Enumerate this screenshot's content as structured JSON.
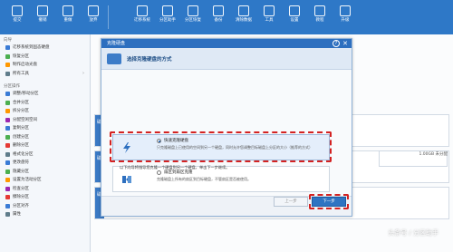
{
  "ribbon": {
    "buttons": [
      {
        "label": "提交"
      },
      {
        "label": "撤销"
      },
      {
        "label": "重做"
      },
      {
        "label": "放弃"
      },
      {
        "label": "迁移系统"
      },
      {
        "label": "分区助手"
      },
      {
        "label": "分区恢复"
      },
      {
        "label": "备份"
      },
      {
        "label": "清除数据"
      },
      {
        "label": "工具"
      },
      {
        "label": "设置"
      },
      {
        "label": "教程"
      },
      {
        "label": "升级"
      }
    ]
  },
  "sidebar": {
    "sections": [
      {
        "title": "向导",
        "items": [
          {
            "label": "迁移系统到固态硬盘",
            "color": "#3a7bd5"
          },
          {
            "label": "恢复分区",
            "color": "#4caf50"
          },
          {
            "label": "制作启动光盘",
            "color": "#ff9800"
          },
          {
            "label": "所有工具",
            "color": "#607d8b",
            "chevron": "›"
          }
        ]
      },
      {
        "title": "分区操作",
        "items": [
          {
            "label": "调整/移动分区",
            "color": "#3a7bd5"
          },
          {
            "label": "合并分区",
            "color": "#4caf50"
          },
          {
            "label": "拆分分区",
            "color": "#ff9800"
          },
          {
            "label": "分配空闲空间",
            "color": "#9c27b0"
          },
          {
            "label": "复制分区",
            "color": "#3a7bd5"
          },
          {
            "label": "创建分区",
            "color": "#4caf50"
          },
          {
            "label": "删除分区",
            "color": "#e53935"
          },
          {
            "label": "格式化分区",
            "color": "#607d8b"
          },
          {
            "label": "更改盘符",
            "color": "#3a7bd5"
          },
          {
            "label": "隐藏分区",
            "color": "#4caf50"
          },
          {
            "label": "设置为活动分区",
            "color": "#ff9800"
          },
          {
            "label": "检查分区",
            "color": "#9c27b0"
          },
          {
            "label": "擦除分区",
            "color": "#e53935"
          },
          {
            "label": "分区对齐",
            "color": "#3a7bd5"
          },
          {
            "label": "属性",
            "color": "#607d8b"
          }
        ]
      }
    ]
  },
  "main": {
    "disk_tag": "磁",
    "side_label": "1.00GB 未分配"
  },
  "dialog": {
    "title": "克隆硬盘",
    "help": "?",
    "close": "✕",
    "heading": "选择克隆硬盘的方式",
    "option1": {
      "label": "快速克隆硬盘",
      "desc": "只克隆磁盘上已使用的空间到另一个硬盘，同时允许您调整目标磁盘上分区的大小（推荐的方式）"
    },
    "option2": {
      "label": "扇区到扇区克隆",
      "desc": "克隆磁盘上所有的扇区到目标硬盘，不管扇区是否被使用。"
    },
    "note": "以下向导将指导您克隆一个硬盘到另一个硬盘，单击下一步继续。",
    "back_label": "上一步",
    "next_label": "下一步"
  },
  "watermark": "头条号 / 分区助手"
}
